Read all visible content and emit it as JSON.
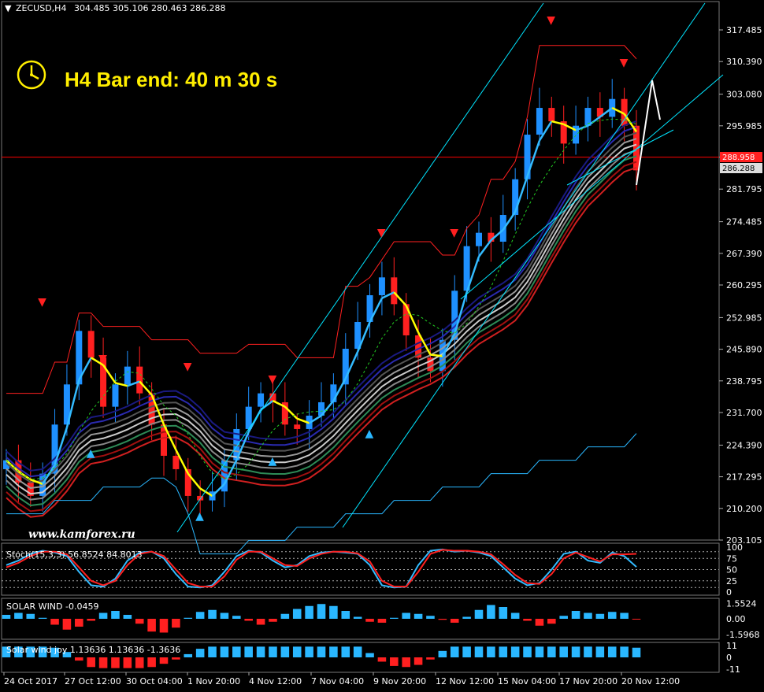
{
  "header": {
    "symbol_timeframe": "ZECUSD,H4",
    "ohlc": "304.485 305.106 280.463 286.288"
  },
  "timer": {
    "label": "H4 Bar end: 40 m 30 s"
  },
  "watermark": "www.kamforex.ru",
  "price_labels": {
    "line": "288.958",
    "current": "286.288"
  },
  "colors": {
    "background": "#000000",
    "bull": "#1e90ff",
    "bear": "#ff2020",
    "timer": "#ffee00",
    "channel": "#00e5ff",
    "price_line": "#ff0000"
  },
  "chart_data": [
    {
      "type": "line",
      "title": "ZECUSD,H4",
      "y_ticks": [
        "317.485",
        "310.390",
        "303.080",
        "295.985",
        "288.958",
        "281.795",
        "274.485",
        "267.390",
        "260.295",
        "252.985",
        "245.890",
        "238.795",
        "231.700",
        "224.390",
        "217.295",
        "210.200",
        "203.105"
      ],
      "ylim": [
        203.105,
        321.0
      ],
      "x_ticks": [
        "24 Oct 2017",
        "27 Oct 12:00",
        "30 Oct 04:00",
        "1 Nov 20:00",
        "4 Nov 12:00",
        "7 Nov 04:00",
        "9 Nov 20:00",
        "12 Nov 12:00",
        "15 Nov 04:00",
        "17 Nov 20:00",
        "20 Nov 12:00"
      ],
      "series": [
        {
          "values": [
            221,
            216,
            213,
            218,
            229,
            238,
            250,
            244,
            233,
            238,
            242,
            236,
            229,
            222,
            219,
            213,
            212,
            214,
            221,
            228,
            233,
            236,
            234,
            229,
            228,
            231,
            234,
            238,
            246,
            252,
            258,
            262,
            256,
            249,
            244,
            241,
            248,
            259,
            269,
            272,
            270,
            276,
            284,
            294,
            300,
            297,
            292,
            296,
            300,
            298,
            302,
            296,
            286
          ]
        }
      ]
    },
    {
      "type": "line",
      "title": "Stoch(15,3,3) 56.8524 84.8013",
      "y_ticks": [
        "100",
        "75",
        "50",
        "25",
        "0"
      ],
      "ylim": [
        0,
        100
      ],
      "levels": [
        90,
        75,
        50,
        25,
        10
      ],
      "series": [
        {
          "values": [
            60,
            70,
            85,
            92,
            88,
            80,
            45,
            15,
            12,
            30,
            70,
            88,
            90,
            75,
            40,
            12,
            10,
            15,
            45,
            80,
            92,
            88,
            70,
            55,
            60,
            80,
            88,
            90,
            88,
            85,
            60,
            15,
            10,
            12,
            60,
            92,
            95,
            90,
            92,
            88,
            80,
            55,
            30,
            15,
            20,
            50,
            85,
            90,
            70,
            65,
            88,
            80,
            56
          ]
        },
        {
          "values": [
            55,
            65,
            80,
            90,
            90,
            84,
            55,
            25,
            15,
            25,
            60,
            85,
            90,
            80,
            50,
            20,
            12,
            12,
            35,
            72,
            90,
            90,
            75,
            60,
            58,
            75,
            85,
            90,
            90,
            86,
            68,
            25,
            12,
            12,
            45,
            85,
            94,
            92,
            92,
            90,
            84,
            62,
            38,
            20,
            18,
            40,
            75,
            88,
            78,
            68,
            84,
            84,
            85
          ]
        }
      ]
    },
    {
      "type": "bar",
      "title": "SOLAR WIND -0.0459",
      "y_ticks": [
        "1.5524",
        "0.00",
        "-1.5968"
      ],
      "ylim": [
        -1.5968,
        1.5524
      ],
      "values": [
        0.4,
        0.6,
        0.5,
        0.1,
        -0.6,
        -1.1,
        -0.8,
        -0.2,
        0.6,
        0.8,
        0.4,
        -0.5,
        -1.3,
        -1.4,
        -0.9,
        0.1,
        0.7,
        0.9,
        0.6,
        0.3,
        -0.2,
        -0.6,
        -0.3,
        0.5,
        1.0,
        1.3,
        1.5,
        1.3,
        0.8,
        0.2,
        -0.3,
        -0.4,
        0.1,
        0.6,
        0.5,
        0.3,
        -0.1,
        -0.4,
        0.2,
        0.9,
        1.4,
        1.2,
        0.6,
        -0.2,
        -0.7,
        -0.5,
        0.3,
        0.8,
        0.6,
        0.5,
        0.7,
        0.6,
        -0.05
      ]
    },
    {
      "type": "bar",
      "title": "Solar wind joy 1.13636 1.13636 -1.3636",
      "y_ticks": [
        "11",
        "0",
        "-11"
      ],
      "ylim": [
        -11,
        11
      ],
      "values": [
        10,
        10,
        10,
        10,
        9,
        5,
        -3,
        -9,
        -10,
        -10,
        -10,
        -10,
        -9,
        -6,
        -2,
        3,
        8,
        10,
        10,
        10,
        10,
        10,
        10,
        10,
        10,
        10,
        10,
        10,
        10,
        10,
        4,
        -4,
        -8,
        -9,
        -7,
        -2,
        6,
        10,
        10,
        10,
        10,
        10,
        10,
        10,
        10,
        10,
        10,
        10,
        10,
        10,
        10,
        10,
        9
      ]
    }
  ]
}
